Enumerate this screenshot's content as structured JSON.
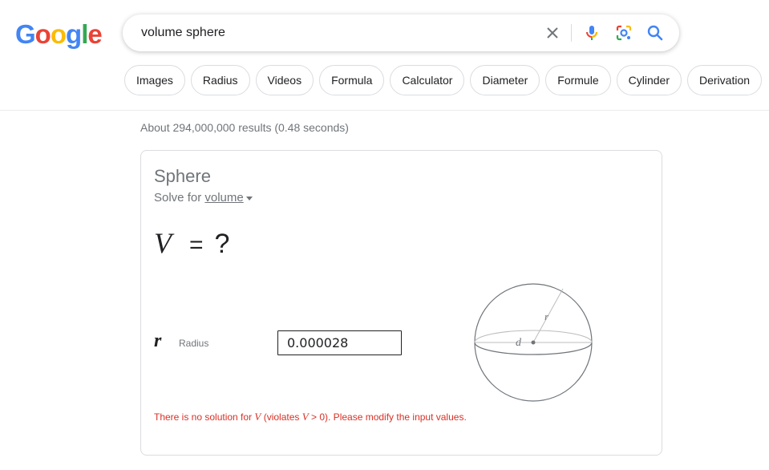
{
  "logo": {
    "letters": [
      "G",
      "o",
      "o",
      "g",
      "l",
      "e"
    ],
    "colors": [
      "#4285F4",
      "#EA4335",
      "#FBBC05",
      "#4285F4",
      "#34A853",
      "#EA4335"
    ]
  },
  "search": {
    "query": "volume sphere"
  },
  "chips": [
    "Images",
    "Radius",
    "Videos",
    "Formula",
    "Calculator",
    "Diameter",
    "Formule",
    "Cylinder",
    "Derivation"
  ],
  "result_stats": "About 294,000,000 results (0.48 seconds)",
  "card": {
    "title": "Sphere",
    "solve_prefix": "Solve for ",
    "solve_target": "volume",
    "equation": {
      "variable": "V",
      "equals": "=",
      "unknown": "?"
    },
    "input": {
      "symbol": "r",
      "label": "Radius",
      "value": "0.000028"
    },
    "diagram": {
      "radius_label": "r",
      "diameter_label": "d"
    },
    "error": {
      "part1": "There is no solution for ",
      "var1": "V",
      "part2": " (violates ",
      "var2": "V",
      "part3": " > 0). Please modify the input values."
    }
  },
  "colors": {
    "error": "#d93025",
    "blue": "#4285F4",
    "muted": "#70757a"
  }
}
